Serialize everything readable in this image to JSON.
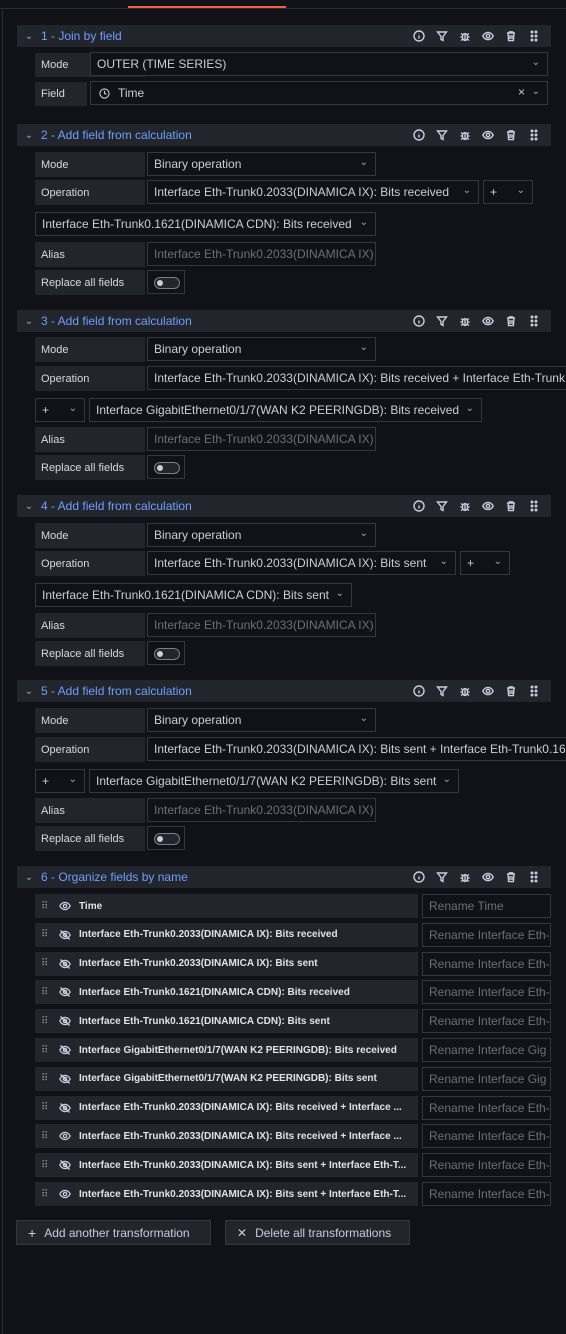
{
  "sections": [
    {
      "title": "1 - Join by field"
    },
    {
      "title": "2 - Add field from calculation"
    },
    {
      "title": "3 - Add field from calculation"
    },
    {
      "title": "4 - Add field from calculation"
    },
    {
      "title": "5 - Add field from calculation"
    },
    {
      "title": "6 - Organize fields by name"
    }
  ],
  "labels": {
    "mode": "Mode",
    "field": "Field",
    "operation": "Operation",
    "alias": "Alias",
    "replace_all": "Replace all fields"
  },
  "s1": {
    "mode_value": "OUTER (TIME SERIES)",
    "field_value": "Time"
  },
  "s2": {
    "mode_value": "Binary operation",
    "op_left": "Interface Eth-Trunk0.2033(DINAMICA IX): Bits received",
    "operator": "+",
    "op_right": "Interface Eth-Trunk0.1621(DINAMICA CDN): Bits received",
    "alias_placeholder": "Interface Eth-Trunk0.2033(DINAMICA IX)"
  },
  "s3": {
    "mode_value": "Binary operation",
    "op_left": "Interface Eth-Trunk0.2033(DINAMICA IX): Bits received + Interface Eth-Trunk",
    "operator": "+",
    "op_right": "Interface GigabitEthernet0/1/7(WAN K2 PEERINGDB): Bits received",
    "alias_placeholder": "Interface Eth-Trunk0.2033(DINAMICA IX)"
  },
  "s4": {
    "mode_value": "Binary operation",
    "op_left": "Interface Eth-Trunk0.2033(DINAMICA IX): Bits sent",
    "operator": "+",
    "op_right": "Interface Eth-Trunk0.1621(DINAMICA CDN): Bits sent",
    "alias_placeholder": "Interface Eth-Trunk0.2033(DINAMICA IX)"
  },
  "s5": {
    "mode_value": "Binary operation",
    "op_left": "Interface Eth-Trunk0.2033(DINAMICA IX): Bits sent + Interface Eth-Trunk0.16",
    "operator": "+",
    "op_right": "Interface GigabitEthernet0/1/7(WAN K2 PEERINGDB): Bits sent",
    "alias_placeholder": "Interface Eth-Trunk0.2033(DINAMICA IX)"
  },
  "organize": [
    {
      "name": "Time",
      "rename": "Rename Time",
      "visible": true
    },
    {
      "name": "Interface Eth-Trunk0.2033(DINAMICA IX): Bits received",
      "rename": "Rename Interface Eth-",
      "visible": false
    },
    {
      "name": "Interface Eth-Trunk0.2033(DINAMICA IX): Bits sent",
      "rename": "Rename Interface Eth-",
      "visible": false
    },
    {
      "name": "Interface Eth-Trunk0.1621(DINAMICA CDN): Bits received",
      "rename": "Rename Interface Eth-",
      "visible": false
    },
    {
      "name": "Interface Eth-Trunk0.1621(DINAMICA CDN): Bits sent",
      "rename": "Rename Interface Eth-",
      "visible": false
    },
    {
      "name": "Interface GigabitEthernet0/1/7(WAN K2 PEERINGDB): Bits received",
      "rename": "Rename Interface Gig",
      "visible": false
    },
    {
      "name": "Interface GigabitEthernet0/1/7(WAN K2 PEERINGDB): Bits sent",
      "rename": "Rename Interface Gig",
      "visible": false
    },
    {
      "name": "Interface Eth-Trunk0.2033(DINAMICA IX): Bits received + Interface ...",
      "rename": "Rename Interface Eth-",
      "visible": false
    },
    {
      "name": "Interface Eth-Trunk0.2033(DINAMICA IX): Bits received + Interface ...",
      "rename": "Rename Interface Eth-",
      "visible": true
    },
    {
      "name": "Interface Eth-Trunk0.2033(DINAMICA IX): Bits sent + Interface Eth-T...",
      "rename": "Rename Interface Eth-",
      "visible": false
    },
    {
      "name": "Interface Eth-Trunk0.2033(DINAMICA IX): Bits sent + Interface Eth-T...",
      "rename": "Rename Interface Eth-",
      "visible": true
    }
  ],
  "buttons": {
    "add": "Add another transformation",
    "delete": "Delete all transformations"
  },
  "icons": [
    "chevron-down-icon",
    "info-icon",
    "filter-icon",
    "bug-icon",
    "eye-icon",
    "trash-icon",
    "drag-handle-icon",
    "clock-icon",
    "eye-slash-icon",
    "plus-icon",
    "close-icon"
  ],
  "colors": {
    "accent": "#f55f3e",
    "title": "#6e9fff",
    "background": "#111217",
    "panel": "#22252b"
  }
}
